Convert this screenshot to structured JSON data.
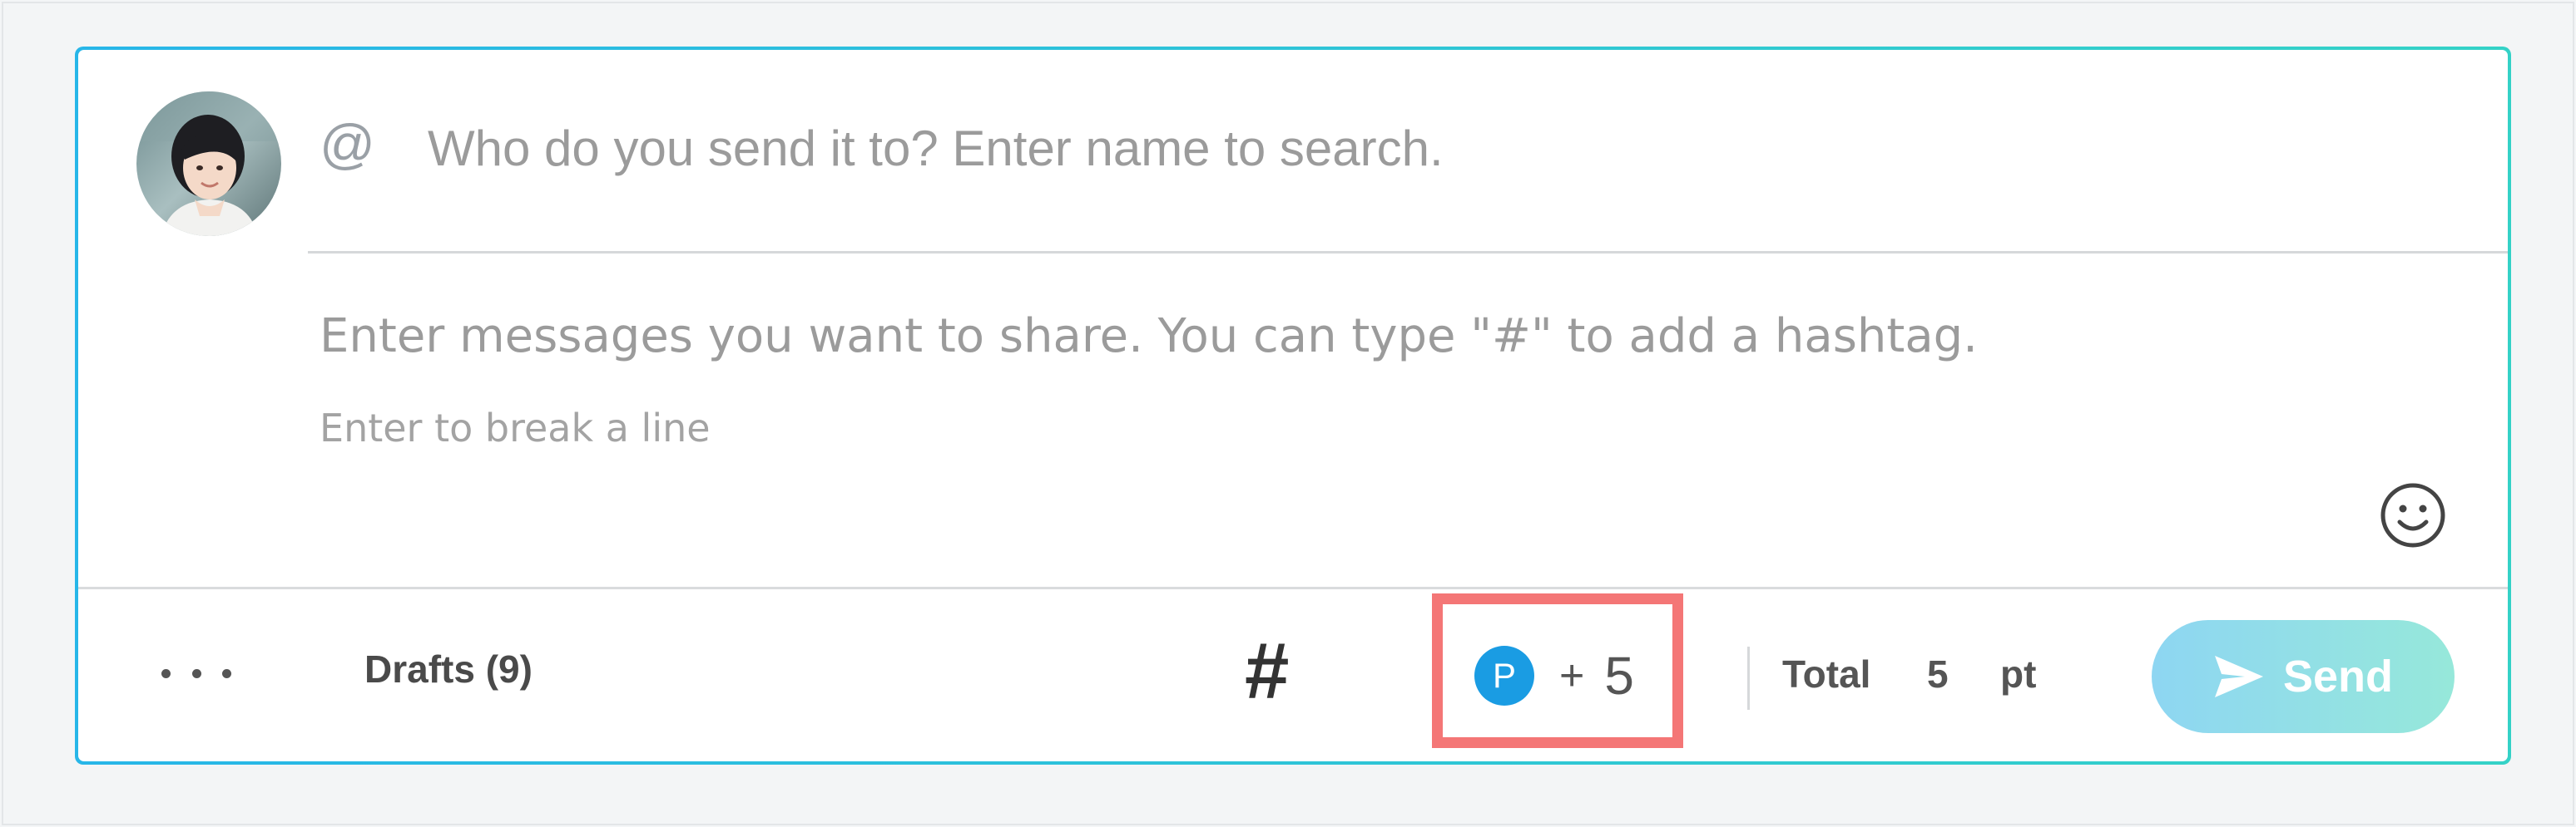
{
  "composer": {
    "recipient": {
      "at_symbol": "@",
      "placeholder": "Who do you send it to? Enter name to search.",
      "value": ""
    },
    "message": {
      "placeholder": "Enter messages you want to share. You can type \"#\" to add a hashtag.",
      "value": "",
      "hint": "Enter to break a line"
    },
    "icons": {
      "avatar": "user-avatar",
      "emoji": "smiley-face-icon",
      "more": "more-horizontal-icon",
      "hashtag": "hashtag-icon",
      "send": "paper-plane-icon"
    }
  },
  "footer": {
    "drafts_label": "Drafts (9)",
    "hashtag_symbol": "#",
    "points": {
      "badge_letter": "P",
      "plus": "+",
      "value": "5"
    },
    "total": {
      "label": "Total",
      "value": "5",
      "unit": "pt"
    },
    "send_label": "Send"
  },
  "colors": {
    "border_gradient_start": "#27b6e8",
    "border_gradient_end": "#34d2c7",
    "points_badge": "#1a9ce3",
    "highlight": "#f47676",
    "send_gradient_start": "#8ed6f2",
    "send_gradient_end": "#96e8da"
  }
}
